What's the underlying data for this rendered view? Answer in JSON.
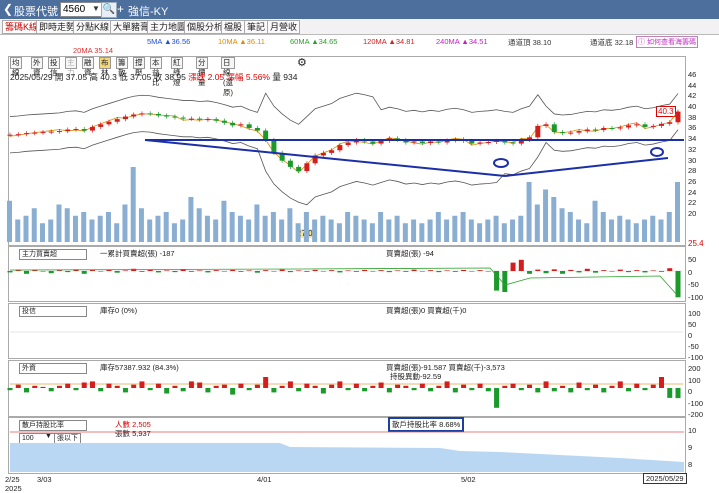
{
  "header": {
    "back_icon": "chevron-left-icon",
    "stock_label": "股票代號",
    "stock_code": "4560",
    "stock_name": "強信-KY"
  },
  "tabs": [
    {
      "label": "籌碼K線",
      "active": true
    },
    {
      "label": "即時走勢"
    },
    {
      "label": "分點K線"
    },
    {
      "label": "大單豬膏"
    },
    {
      "label": "主力地圖"
    },
    {
      "label": "個股分析"
    },
    {
      "label": "檔股"
    },
    {
      "label": "筆記"
    },
    {
      "label": "月營收"
    }
  ],
  "ma_legend": {
    "ma5": "5MA ▲36.56",
    "ma10": "10MA ▲36.11",
    "ma60": "60MA ▲34.65",
    "ma120": "120MA ▲34.81",
    "ma240": "240MA ▲34.51",
    "upper": "通道頂 38.10",
    "lower": "通道底 32.18",
    "ma20": "20MA 35.14",
    "help": "ⓘ 如何查看海籌碼",
    "colors": {
      "ma5": "#1f4fd0",
      "ma10": "#e08a00",
      "ma60": "#2aa12a",
      "ma120": "#d02020",
      "ma240": "#c020c0",
      "ma20": "#e03030"
    }
  },
  "toolbar": [
    {
      "label": "均線"
    },
    {
      "label": "外資"
    },
    {
      "label": "投信"
    },
    {
      "label": "主力",
      "disabled": true
    },
    {
      "label": "融資"
    },
    {
      "label": "布林",
      "highlight": true
    },
    {
      "label": "籌散"
    },
    {
      "label": "撐壓"
    },
    {
      "label": "本益比"
    },
    {
      "label": "紅綠燈"
    },
    {
      "label": "分價量"
    },
    {
      "label": "日線(還原)"
    }
  ],
  "quote": {
    "date": "2025/05/29",
    "open": "開 37.05",
    "high": "高 40.3",
    "low": "低 37.05",
    "close": "收 38.95",
    "change": "漲跌 2.05",
    "pct": "漲幅 5.56%",
    "vol": "量 934"
  },
  "price_axis": [
    "46",
    "44",
    "42",
    "40",
    "38",
    "36",
    "34",
    "32",
    "30",
    "28",
    "26",
    "24",
    "22",
    "20"
  ],
  "callouts": {
    "high": "40.3",
    "low": "27.0",
    "right_edge": "25.4"
  },
  "panels": {
    "main_force": {
      "select": "主力買賣超",
      "acc": "一累計買賣超(張) -187",
      "daily": "買賣超(張) -94",
      "axis": [
        "50",
        "0",
        "-50",
        "-100"
      ]
    },
    "trust": {
      "select": "投信",
      "hold": "庫存0 (0%)",
      "daily": "買賣超(張)0 買賣超(千)0",
      "axis": [
        "100",
        "50",
        "0",
        "-50",
        "-100"
      ]
    },
    "foreign": {
      "select": "外資",
      "hold": "庫存57387.932 (84.3%)",
      "daily": "買賣超(張)-91.587 買賣超(千)-3,573",
      "cost": "持股異動-92.59",
      "axis": [
        "200",
        "100",
        "0",
        "-100",
        "-200"
      ]
    },
    "holders": {
      "select": "散戶持股比率",
      "people": "人數 2,505",
      "count": "張數 5,937",
      "ratio": "散戶持股比率 8.68%",
      "threshold": "100",
      "threshold_unit": "張以下",
      "axis": [
        "10",
        "9",
        "8"
      ]
    }
  },
  "x_labels": [
    "2/25",
    "3/03",
    "4/01",
    "5/02"
  ],
  "year_label": "2025",
  "cursor_date": "2025/05/29",
  "chart_data": {
    "type": "candlestick",
    "ylim": [
      20,
      46
    ],
    "close_series": [
      34.5,
      34.6,
      34.8,
      34.9,
      35.0,
      35.1,
      35.2,
      35.5,
      35.6,
      35.3,
      36.0,
      36.5,
      37.0,
      37.5,
      38.0,
      38.4,
      38.6,
      38.5,
      38.2,
      38.0,
      37.8,
      37.6,
      37.6,
      37.4,
      37.5,
      37.2,
      36.8,
      36.3,
      36.5,
      35.8,
      35.3,
      33.5,
      31.0,
      29.5,
      28.3,
      27.5,
      29.0,
      30.5,
      31.0,
      31.5,
      32.5,
      33.0,
      33.5,
      33.2,
      32.8,
      33.3,
      33.8,
      33.5,
      33.0,
      33.2,
      32.9,
      33.2,
      33.0,
      33.4,
      33.6,
      33.3,
      32.8,
      33.0,
      33.1,
      33.3,
      33.0,
      32.8,
      33.5,
      34.0,
      36.2,
      36.5,
      35.0,
      34.8,
      34.9,
      35.2,
      35.5,
      35.4,
      35.8,
      35.7,
      35.9,
      36.3,
      36.5,
      36.0,
      36.2,
      36.6,
      36.9,
      38.95
    ],
    "volume_pct": [
      0.55,
      0.3,
      0.35,
      0.45,
      0.25,
      0.3,
      0.5,
      0.45,
      0.35,
      0.4,
      0.3,
      0.35,
      0.4,
      0.25,
      0.5,
      1.0,
      0.45,
      0.3,
      0.35,
      0.4,
      0.25,
      0.3,
      0.6,
      0.45,
      0.35,
      0.3,
      0.55,
      0.4,
      0.35,
      0.3,
      0.5,
      0.35,
      0.4,
      0.3,
      0.45,
      0.25,
      0.4,
      0.3,
      0.35,
      0.3,
      0.25,
      0.4,
      0.35,
      0.3,
      0.25,
      0.4,
      0.3,
      0.35,
      0.25,
      0.3,
      0.25,
      0.3,
      0.4,
      0.3,
      0.35,
      0.4,
      0.3,
      0.25,
      0.3,
      0.35,
      0.25,
      0.3,
      0.35,
      0.8,
      0.5,
      0.7,
      0.6,
      0.45,
      0.4,
      0.3,
      0.25,
      0.55,
      0.4,
      0.3,
      0.35,
      0.3,
      0.25,
      0.3,
      0.35,
      0.3,
      0.4,
      0.8
    ],
    "main_force": [
      -0.05,
      0.05,
      -0.1,
      0.05,
      0,
      -0.08,
      0.03,
      -0.04,
      0.06,
      -0.1,
      0.04,
      -0.02,
      0.05,
      -0.06,
      0.02,
      0.08,
      -0.03,
      0.04,
      -0.05,
      0.02,
      -0.04,
      0.06,
      -0.03,
      0.02,
      -0.05,
      0.03,
      -0.02,
      0.04,
      -0.03,
      0.02,
      -0.06,
      0.03,
      -0.02,
      0.05,
      -0.04,
      0.02,
      -0.03,
      0.04,
      -0.02,
      0.03,
      -0.05,
      0.02,
      -0.03,
      0.04,
      -0.02,
      0.03,
      -0.04,
      0.02,
      -0.03,
      0.05,
      -0.02,
      0.03,
      -0.04,
      0.02,
      -0.03,
      0.04,
      -0.02,
      0.03,
      -0.02,
      -0.7,
      -0.75,
      0.3,
      0.4,
      -0.1,
      0.05,
      -0.08,
      0.06,
      -0.1,
      0.04,
      -0.05,
      0.08,
      -0.06,
      0.03,
      -0.02,
      0.05,
      -0.04,
      0.03,
      -0.05,
      0.02,
      -0.03,
      0.1,
      -0.94
    ],
    "foreign": [
      -0.1,
      0.15,
      -0.2,
      0.1,
      0.05,
      -0.15,
      0.1,
      0.2,
      -0.1,
      0.25,
      0.3,
      -0.15,
      0.2,
      0.1,
      -0.2,
      0.15,
      0.3,
      -0.1,
      0.2,
      -0.25,
      0.1,
      -0.15,
      0.3,
      0.25,
      -0.2,
      0.1,
      0.15,
      -0.3,
      0.2,
      -0.1,
      0.15,
      0.5,
      -0.2,
      0.1,
      0.3,
      -0.15,
      0.2,
      0.1,
      -0.25,
      0.15,
      0.3,
      -0.1,
      0.2,
      -0.15,
      0.1,
      0.25,
      -0.2,
      0.15,
      0.1,
      -0.1,
      0.2,
      -0.15,
      0.1,
      0.3,
      -0.2,
      0.15,
      -0.1,
      0.2,
      -0.15,
      -0.9,
      0.1,
      0.2,
      -0.1,
      0.15,
      -0.2,
      0.3,
      -0.15,
      0.1,
      -0.2,
      0.25,
      -0.1,
      0.15,
      -0.2,
      0.1,
      0.3,
      -0.15,
      0.2,
      -0.1,
      0.15,
      0.5,
      -0.45,
      -0.46
    ]
  }
}
